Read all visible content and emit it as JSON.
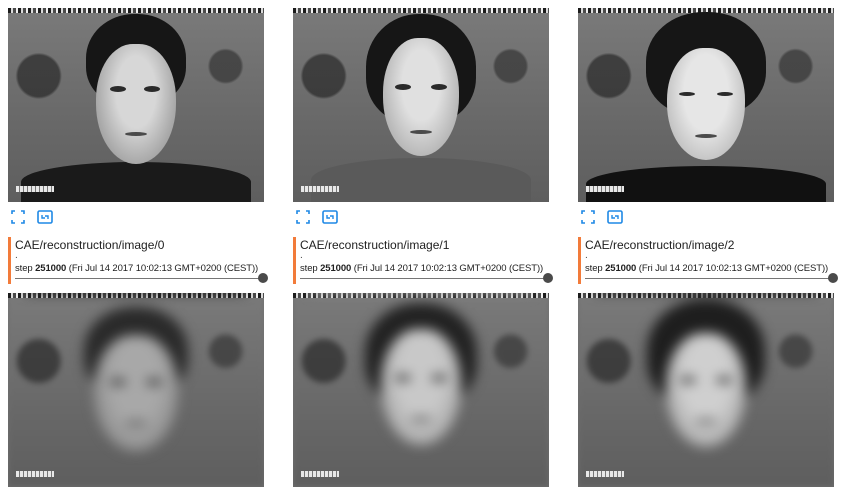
{
  "cards": [
    {
      "tag": "CAE/reconstruction/image/0",
      "dot": ".",
      "step_label": "step",
      "step_value": "251000",
      "step_time": "(Fri Jul 14 2017 10:02:13 GMT+0200 (CEST))",
      "slider_fraction": 1.0,
      "top_image": "grayscale-face-input",
      "bottom_image": "grayscale-face-reconstruction"
    },
    {
      "tag": "CAE/reconstruction/image/1",
      "dot": ".",
      "step_label": "step",
      "step_value": "251000",
      "step_time": "(Fri Jul 14 2017 10:02:13 GMT+0200 (CEST))",
      "slider_fraction": 1.0,
      "top_image": "grayscale-face-input",
      "bottom_image": "grayscale-face-reconstruction"
    },
    {
      "tag": "CAE/reconstruction/image/2",
      "dot": ".",
      "step_label": "step",
      "step_value": "251000",
      "step_time": "(Fri Jul 14 2017 10:02:13 GMT+0200 (CEST))",
      "slider_fraction": 1.0,
      "top_image": "grayscale-face-input",
      "bottom_image": "grayscale-face-reconstruction"
    }
  ],
  "icons": {
    "fit": "fit-to-screen-icon",
    "expand": "expand-image-icon"
  },
  "colors": {
    "accent_bar": "#f27b3a",
    "icon_blue": "#1e88e5",
    "slider_knob": "#4a4a4a"
  }
}
